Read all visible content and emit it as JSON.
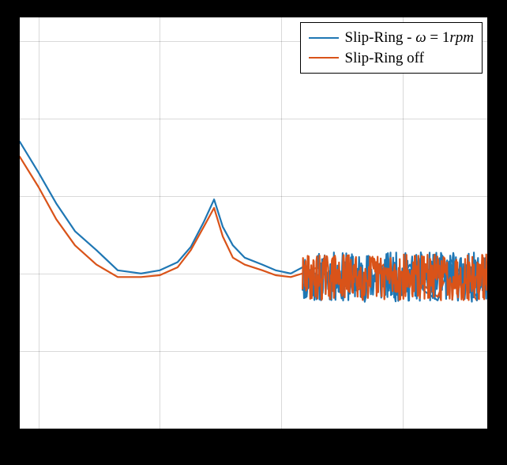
{
  "chart_data": {
    "type": "line",
    "title": "",
    "xlabel": "",
    "ylabel": "",
    "xscale": "log",
    "yscale": "log",
    "xlim": [
      0.07,
      500
    ],
    "ylim": [
      1e-09,
      0.0002
    ],
    "gridlines_x": [
      0.1,
      1,
      10,
      100
    ],
    "gridlines_y": [
      1e-09,
      1e-08,
      1e-07,
      1e-06,
      1e-05,
      0.0001
    ],
    "legend": {
      "position": "upper right",
      "entries": [
        {
          "name": "Slip-Ring - ω = 1rpm",
          "color": "#1f77b4"
        },
        {
          "name": "Slip-Ring off",
          "color": "#d95319"
        }
      ]
    },
    "series": [
      {
        "name": "Slip-Ring - ω = 1rpm",
        "color": "#1f77b4",
        "x": [
          0.07,
          0.1,
          0.14,
          0.2,
          0.3,
          0.45,
          0.7,
          1,
          1.4,
          1.8,
          2.3,
          2.8,
          3.3,
          4,
          5,
          7,
          9,
          12,
          15,
          20,
          26,
          33,
          42,
          55,
          70,
          90,
          115,
          150,
          195,
          250,
          320,
          410,
          500
        ],
        "y": [
          5e-06,
          2e-06,
          8e-07,
          3.5e-07,
          2e-07,
          1.1e-07,
          1e-07,
          1.1e-07,
          1.4e-07,
          2.2e-07,
          4.6e-07,
          9e-07,
          4e-07,
          2.3e-07,
          1.6e-07,
          1.3e-07,
          1.1e-07,
          1e-07,
          1.2e-07,
          9.5e-08,
          1e-07,
          8e-08,
          7e-08,
          9e-08,
          1.1e-07,
          7e-08,
          1.3e-07,
          6e-08,
          4.5e-08,
          1.5e-07,
          9e-08,
          5e-08,
          1.2e-07
        ]
      },
      {
        "name": "Slip-Ring off",
        "color": "#d95319",
        "x": [
          0.07,
          0.1,
          0.14,
          0.2,
          0.3,
          0.45,
          0.7,
          1,
          1.4,
          1.8,
          2.3,
          2.8,
          3.3,
          4,
          5,
          7,
          9,
          12,
          15,
          20,
          26,
          33,
          42,
          55,
          70,
          90,
          115,
          150,
          195,
          250,
          320,
          410,
          500
        ],
        "y": [
          3.2e-06,
          1.3e-06,
          5e-07,
          2.3e-07,
          1.3e-07,
          9e-08,
          9e-08,
          9.5e-08,
          1.2e-07,
          2e-07,
          4e-07,
          7e-07,
          3e-07,
          1.6e-07,
          1.3e-07,
          1.1e-07,
          9.5e-08,
          9e-08,
          1e-07,
          1.2e-07,
          8e-08,
          1e-07,
          6e-08,
          8e-08,
          1.3e-07,
          6e-08,
          1.1e-07,
          7e-08,
          5e-08,
          1.3e-07,
          8e-08,
          4.5e-08,
          1.4e-07
        ]
      }
    ]
  },
  "legend_labels": {
    "a_pre": "Slip-Ring - ",
    "a_omega": "ω",
    "a_eq": " = 1",
    "a_unit": "rpm",
    "b": "Slip-Ring off"
  }
}
